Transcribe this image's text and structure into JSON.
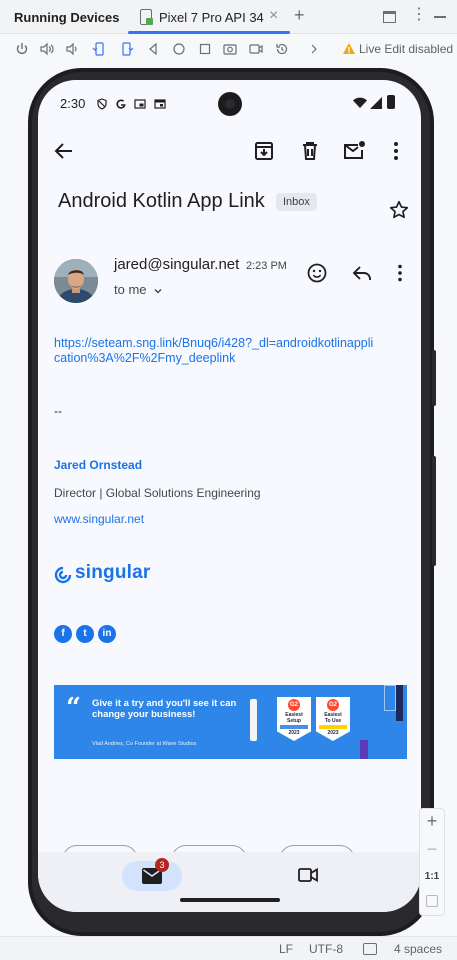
{
  "ide": {
    "panel_title": "Running Devices",
    "device_tab": "Pixel 7 Pro API 34",
    "tab_close": "×",
    "new_tab": "+",
    "more": "⋮",
    "live_edit": "Live Edit disabled",
    "status_lf": "LF",
    "status_encoding": "UTF-8",
    "status_indent": "4 spaces",
    "zoom_in": "+",
    "zoom_out": "−",
    "zoom_actual": "1:1"
  },
  "phone": {
    "time": "2:30"
  },
  "email": {
    "subject": "Android Kotlin App Link",
    "label_chip": "Inbox",
    "sender": "jared@singular.net",
    "time": "2:23 PM",
    "recipient": "to me",
    "link": "https://seteam.sng.link/Bnuq6/i428?_dl=androidkotlinapplication%3A%2F%2Fmy_deeplink",
    "separator": "--",
    "signature": {
      "name": "Jared Ornstead",
      "title": "Director | Global Solutions Engineering",
      "website": "www.singular.net",
      "company": "singular"
    },
    "socials": [
      "f",
      "t",
      "in"
    ],
    "banner": {
      "headline": "Give it a try and you'll see it can change your business!",
      "attribution": "Vlad Andries, Co Founder at Wave Studios",
      "badges": [
        {
          "logo": "G2",
          "line1": "Easiest",
          "line2": "Setup",
          "year": "2023",
          "stripe": "#4a90e2"
        },
        {
          "logo": "G2",
          "line1": "Easiest",
          "line2": "To Use",
          "year": "2023",
          "stripe": "#ffd200"
        }
      ]
    },
    "unread_badge": "3"
  },
  "colors": {
    "accent": "#1a73e8",
    "ide_tab_underline": "#3574f0",
    "banner": "#2f86e9",
    "badge": "#b3261e"
  }
}
